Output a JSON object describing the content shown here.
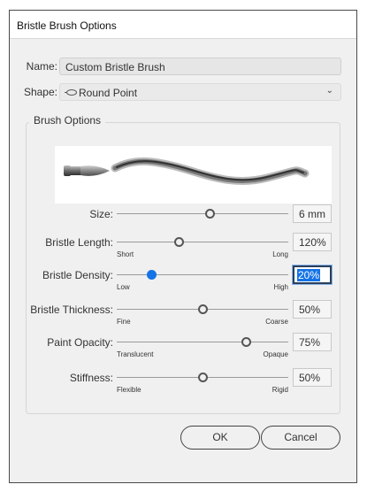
{
  "window": {
    "title": "Bristle Brush Options"
  },
  "name": {
    "label": "Name:",
    "value": "Custom Bristle Brush"
  },
  "shape": {
    "label": "Shape:",
    "value": "Round Point"
  },
  "group": {
    "title": "Brush Options"
  },
  "sliders": [
    {
      "id": "size",
      "label": "Size:",
      "value": "6 mm",
      "min_label": "",
      "max_label": "",
      "fraction": 0.54
    },
    {
      "id": "bristle-length",
      "label": "Bristle Length:",
      "value": "120%",
      "min_label": "Short",
      "max_label": "Long",
      "fraction": 0.36
    },
    {
      "id": "bristle-density",
      "label": "Bristle Density:",
      "value": "20%",
      "min_label": "Low",
      "max_label": "High",
      "fraction": 0.2
    },
    {
      "id": "bristle-thickness",
      "label": "Bristle Thickness:",
      "value": "50%",
      "min_label": "Fine",
      "max_label": "Coarse",
      "fraction": 0.5
    },
    {
      "id": "paint-opacity",
      "label": "Paint Opacity:",
      "value": "75%",
      "min_label": "Translucent",
      "max_label": "Opaque",
      "fraction": 0.75
    },
    {
      "id": "stiffness",
      "label": "Stiffness:",
      "value": "50%",
      "min_label": "Flexible",
      "max_label": "Rigid",
      "fraction": 0.5
    }
  ],
  "buttons": {
    "ok": "OK",
    "cancel": "Cancel"
  },
  "colors": {
    "accent": "#1473e6",
    "dialog_bg": "#f0f0f0"
  }
}
